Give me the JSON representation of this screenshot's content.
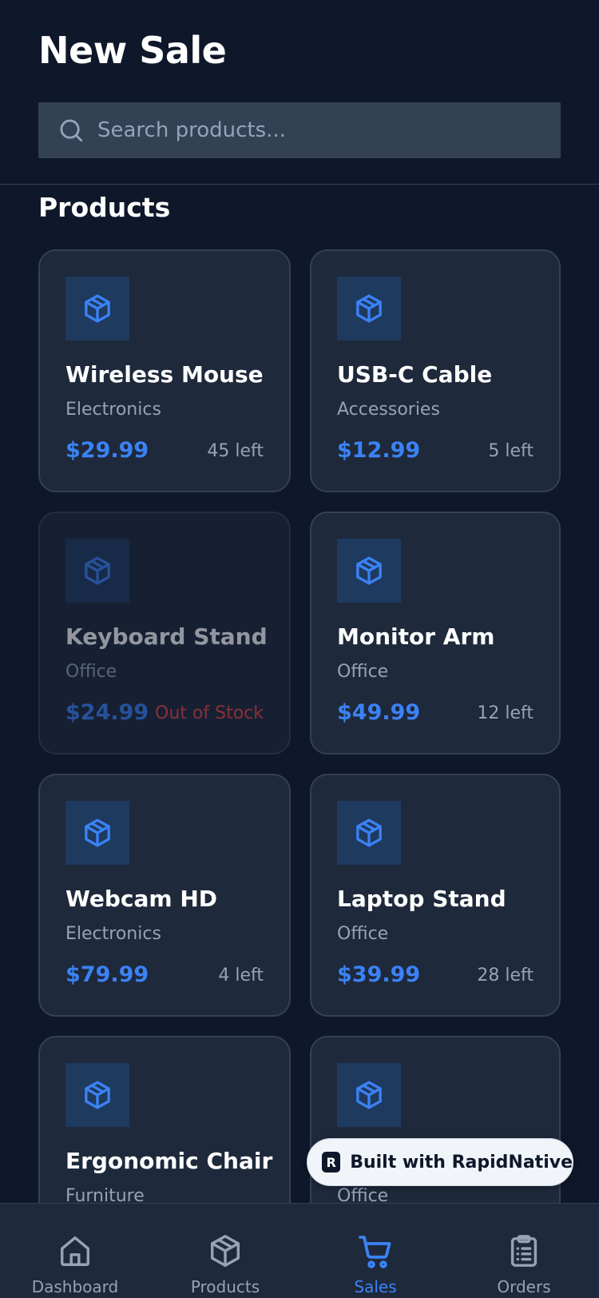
{
  "header": {
    "title": "New Sale"
  },
  "search": {
    "placeholder": "Search products..."
  },
  "section": {
    "title": "Products"
  },
  "products": [
    {
      "name": "Wireless Mouse",
      "category": "Electronics",
      "price": "$29.99",
      "stock": "45 left"
    },
    {
      "name": "USB-C Cable",
      "category": "Accessories",
      "price": "$12.99",
      "stock": "5 left"
    },
    {
      "name": "Keyboard Stand",
      "category": "Office",
      "price": "$24.99",
      "stock": "Out of Stock"
    },
    {
      "name": "Monitor Arm",
      "category": "Office",
      "price": "$49.99",
      "stock": "12 left"
    },
    {
      "name": "Webcam HD",
      "category": "Electronics",
      "price": "$79.99",
      "stock": "4 left"
    },
    {
      "name": "Laptop Stand",
      "category": "Office",
      "price": "$39.99",
      "stock": "28 left"
    },
    {
      "name": "Ergonomic Chair",
      "category": "Furniture",
      "price": "",
      "stock": ""
    },
    {
      "name": "",
      "category": "Office",
      "price": "",
      "stock": ""
    }
  ],
  "badge": {
    "text": "Built with RapidNative",
    "logo": "R"
  },
  "nav": {
    "items": [
      {
        "label": "Dashboard",
        "icon": "home-icon"
      },
      {
        "label": "Products",
        "icon": "box-icon"
      },
      {
        "label": "Sales",
        "icon": "cart-icon"
      },
      {
        "label": "Orders",
        "icon": "clipboard-icon"
      }
    ],
    "active": "Sales"
  },
  "colors": {
    "background": "#0f172a",
    "card": "#1e293b",
    "accent": "#3b82f6",
    "muted": "#94a3b8",
    "danger": "#ef4444"
  }
}
